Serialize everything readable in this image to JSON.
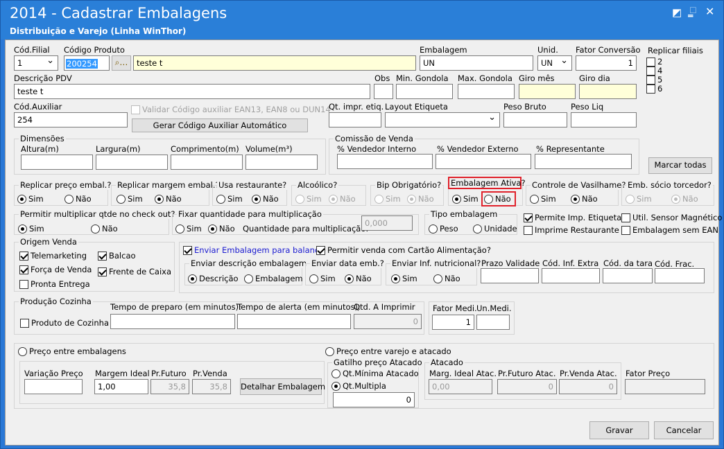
{
  "window": {
    "title": "2014 - Cadastrar Embalagens",
    "subtitle": "Distribuição e Varejo (Linha WinThor)"
  },
  "row1": {
    "filial_label": "Cód.Filial",
    "filial_value": "1",
    "codprod_label": "Código Produto",
    "codprod_value": "200254",
    "product_desc": "teste t",
    "embalagem_label": "Embalagem",
    "embalagem_value": "UN",
    "unid_label": "Unid.",
    "unid_value": "UN",
    "fator_label": "Fator Conversão",
    "fator_value": "1"
  },
  "replicar": {
    "title": "Replicar filiais",
    "items": [
      "2",
      "4",
      "5",
      "6"
    ],
    "button": "Marcar todas"
  },
  "row2": {
    "pdv_label": "Descrição PDV",
    "pdv_value": "teste t",
    "obs_label": "Obs",
    "min_label": "Min. Gondola",
    "max_label": "Max. Gondola",
    "giromes_label": "Giro mês",
    "girodia_label": "Giro dia"
  },
  "row3": {
    "aux_label": "Cód.Auxiliar",
    "aux_value": "254",
    "validar_label": "Validar Código auxiliar EAN13, EAN8 ou DUN14",
    "gerar_button": "Gerar Código Auxiliar Automático",
    "qtimpr_label": "Qt. impr. etiq.",
    "layout_label": "Layout Etiqueta",
    "pesob_label": "Peso Bruto",
    "pesol_label": "Peso Liq"
  },
  "dimensoes": {
    "title": "Dimensões",
    "altura": "Altura(m)",
    "largura": "Largura(m)",
    "comprimento": "Comprimento(m)",
    "volume": "Volume(m³)"
  },
  "comissao": {
    "title": "Comissão de Venda",
    "interno": "% Vendedor Interno",
    "externo": "% Vendedor Externo",
    "representante": "% Representante"
  },
  "opts": {
    "sim": "Sim",
    "nao": "Não"
  },
  "g1": {
    "preco": "Replicar preço embal.?",
    "margem": "Replicar margem embal.?",
    "restaurante": "Usa restaurante?",
    "alcoolico": "Alcoólico?",
    "bip": "Bip Obrigatório?",
    "ativa": "Embalagem Ativa?",
    "vasilhame": "Controle de Vasilhame?",
    "socio": "Emb. sócio torcedor?"
  },
  "g2": {
    "multiplicar": "Permitir multiplicar qtde no check out?",
    "fixar": "Fixar quantidade para multiplicação",
    "qtmult_label": "Quantidade para multiplicação:",
    "qtmult_value": "0,000",
    "tipo": "Tipo embalagem",
    "peso": "Peso",
    "unidade": "Unidade",
    "imp_etiqueta": "Permite Imp. Etiqueta",
    "sensor": "Util. Sensor Magnético",
    "imp_rest": "Imprime Restaurante",
    "sem_ean": "Embalagem sem EAN"
  },
  "origem": {
    "title": "Origem Venda",
    "telemarketing": "Telemarketing",
    "balcao": "Balcao",
    "forca": "Força de Venda",
    "frente": "Frente de Caixa",
    "pronta": "Pronta Entrega"
  },
  "balanca": {
    "enviar": "Enviar Embalagem para balança",
    "alimentacao": "Permitir venda com Cartão Alimentação?",
    "descricao_title": "Enviar descrição embalagem",
    "descricao": "Descrição",
    "embalagem": "Embalagem",
    "data_title": "Enviar data emb.?",
    "nutricional_title": "Enviar Inf. nutricional?",
    "validade": "Prazo Validade",
    "infextra": "Cód. Inf. Extra",
    "tara": "Cód. da tara",
    "frac": "Cód. Frac."
  },
  "cozinha": {
    "title": "Produção Cozinha",
    "produto": "Produto de Cozinha",
    "preparo": "Tempo de preparo (em minutos):",
    "alerta": "Tempo de alerta (em minutos):",
    "qtimprimir": "Qtd. A Imprimir",
    "qtimprimir_value": "0",
    "fator_label": "Fator Medi.",
    "fator_value": "1",
    "unmedi_label": "Un.Medi."
  },
  "precos": {
    "entre_emb": "Preço entre embalagens",
    "variacao": "Variação Preço",
    "margem_ideal": "Margem Ideal",
    "margem_value": "1,00",
    "prfuturo": "Pr.Futuro",
    "prfuturo_value": "35,8",
    "prvenda": "Pr.Venda",
    "prvenda_value": "35,8",
    "detalhar": "Detalhar Embalagem",
    "entre_varejo": "Preço entre varejo e atacado",
    "gatilho": "Gatilho preço Atacado",
    "qtminima": "Qt.Mínima Atacado",
    "qtmultipla": "Qt.Multipla",
    "qtmultipla_value": "0",
    "atacado": "Atacado",
    "marg_atac": "Marg. Ideal Atac.",
    "marg_atac_value": "0,00",
    "prfut_atac": "Pr.Futuro Atac.",
    "prfut_atac_value": "0",
    "prvenda_atac": "Pr.Venda Atac.",
    "prvenda_atac_value": "0",
    "fator_preco": "Fator Preço"
  },
  "actions": {
    "gravar": "Gravar",
    "cancelar": "Cancelar"
  },
  "colors": {
    "titlebar": "#2a7fd8",
    "highlight": "#e0202a",
    "yellow_field": "#ffffd9"
  }
}
